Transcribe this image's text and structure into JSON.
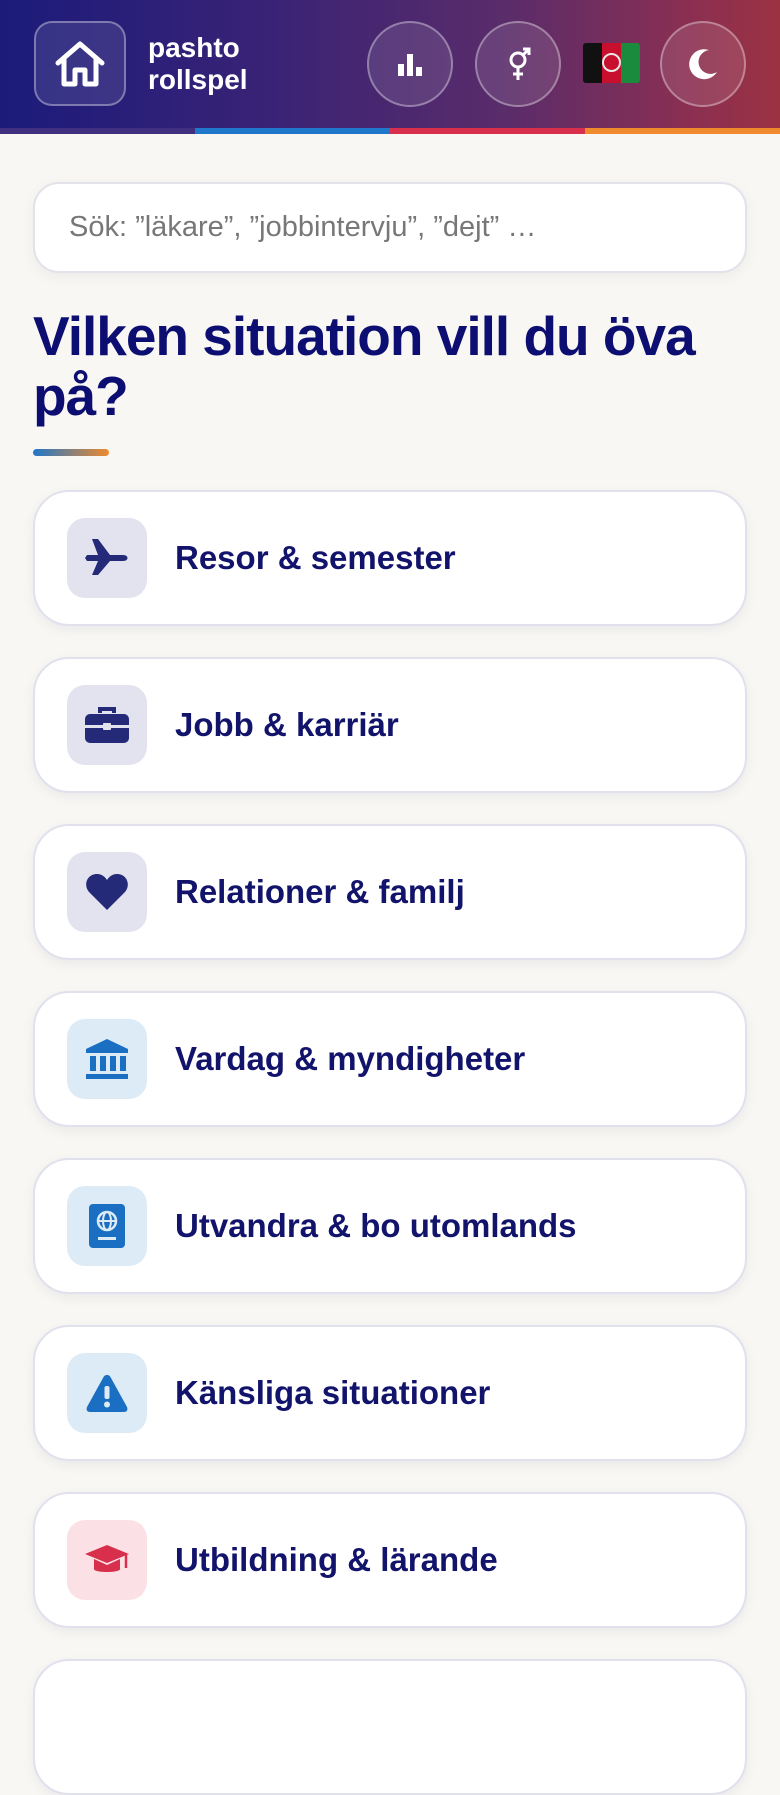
{
  "header": {
    "brand_line1": "pashto",
    "brand_line2": "rollspel",
    "home_icon": "home-icon",
    "stats_icon": "bar-chart-icon",
    "gender_icon": "gender-icon",
    "flag_icon": "afghanistan-flag-icon",
    "theme_icon": "moon-icon"
  },
  "search": {
    "placeholder": "Sök: ”läkare”, ”jobbintervju”, ”dejt” …",
    "value": ""
  },
  "main": {
    "title": "Vilken situation vill du öva på?"
  },
  "categories": [
    {
      "label": "Resor & semester",
      "icon": "airplane-icon",
      "icon_color": "#252a78",
      "icon_bg": "#e3e3f0"
    },
    {
      "label": "Jobb & karriär",
      "icon": "briefcase-icon",
      "icon_color": "#252a78",
      "icon_bg": "#e3e3f0"
    },
    {
      "label": "Relationer & familj",
      "icon": "heart-icon",
      "icon_color": "#252a78",
      "icon_bg": "#e3e3f0"
    },
    {
      "label": "Vardag & myndigheter",
      "icon": "government-building-icon",
      "icon_color": "#1b6fc2",
      "icon_bg": "#ddebf7"
    },
    {
      "label": "Utvandra & bo utomlands",
      "icon": "passport-icon",
      "icon_color": "#1b6fc2",
      "icon_bg": "#ddebf7"
    },
    {
      "label": "Känsliga situationer",
      "icon": "warning-icon",
      "icon_color": "#1b6fc2",
      "icon_bg": "#ddebf7"
    },
    {
      "label": "Utbildning & lärande",
      "icon": "graduation-cap-icon",
      "icon_color": "#d72f4c",
      "icon_bg": "#fbe1e5"
    }
  ],
  "colors": {
    "title": "#0d0e72",
    "stripe": [
      "#3f2f7e",
      "#1f77c9",
      "#d72f4c",
      "#ef8a2d"
    ]
  }
}
